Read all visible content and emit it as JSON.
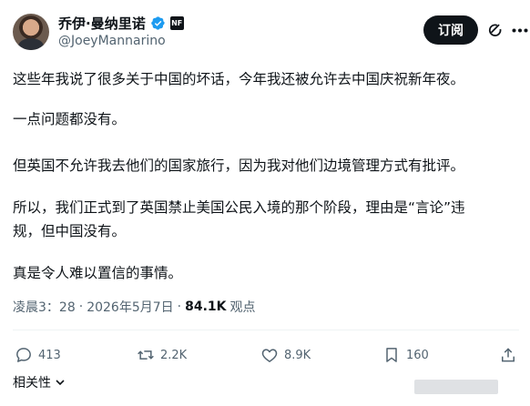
{
  "author": {
    "display_name": "乔伊·曼纳里诺",
    "handle": "@JoeyMannarino",
    "badge_text": "NF"
  },
  "header": {
    "subscribe_label": "订阅"
  },
  "tweet": {
    "paragraphs": [
      "这些年我说了很多关于中国的坏话，今年我还被允许去中国庆祝新年夜。",
      "一点问题都没有。",
      "但英国不允许我去他们的国家旅行，因为我对他们边境管理方式有批评。",
      "所以，我们正式到了英国禁止美国公民入境的那个阶段，理由是“言论”违",
      "规，但中国没有。",
      "真是令人难以置信的事情。"
    ]
  },
  "meta": {
    "time": "凌晨3：28",
    "separator1": "·",
    "date": "2026年5月7日",
    "separator2": "·",
    "views_count": "84.1K",
    "views_label": "观点"
  },
  "actions": {
    "replies": "413",
    "reposts": "2.2K",
    "likes": "8.9K",
    "bookmarks": "160"
  },
  "footer": {
    "related_label": "相关性"
  },
  "colors": {
    "text": "#0f1419",
    "secondary": "#536471",
    "verified": "#1d9bf0",
    "button_bg": "#0f1419"
  }
}
